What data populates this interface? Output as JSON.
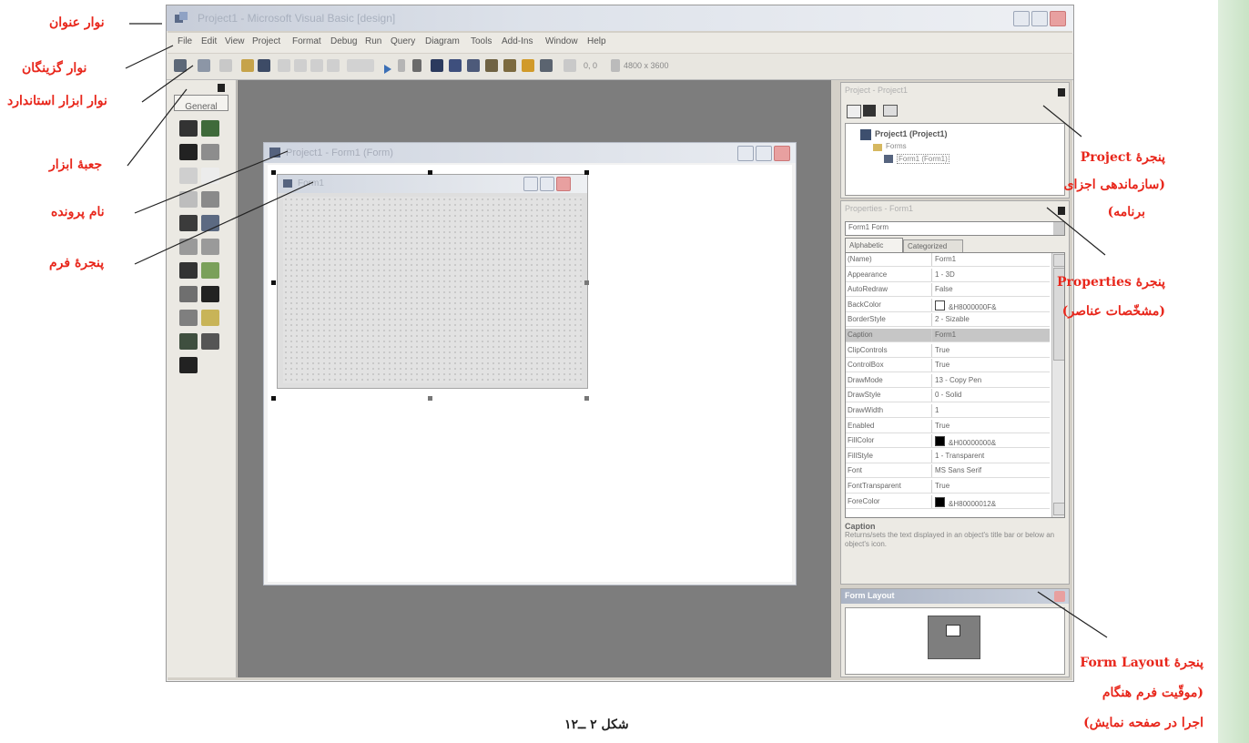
{
  "window": {
    "title": "Project1 - Microsoft Visual Basic [design]"
  },
  "menubar": [
    "File",
    "Edit",
    "View",
    "Project",
    "Format",
    "Debug",
    "Run",
    "Query",
    "Diagram",
    "Tools",
    "Add-Ins",
    "Window",
    "Help"
  ],
  "toolbar": {
    "position_readout": "0, 0",
    "size_readout": "4800 x 3600"
  },
  "toolbox": {
    "tab_label": "General",
    "tools": [
      "pointer",
      "picturebox",
      "label",
      "textbox",
      "frame",
      "commandbutton",
      "checkbox",
      "optionbutton",
      "combobox",
      "listbox",
      "hscrollbar",
      "vscrollbar",
      "timer",
      "drivelistbox",
      "dirlistbox",
      "filelistbox",
      "shape",
      "line",
      "image",
      "data",
      "ole"
    ]
  },
  "project_form_window": {
    "title": "Project1 - Form1 (Form)"
  },
  "form1": {
    "title": "Form1"
  },
  "project_explorer": {
    "title": "Project - Project1",
    "root": "Project1 (Project1)",
    "folder": "Forms",
    "item": "Form1 (Form1)"
  },
  "properties_window": {
    "title": "Properties - Form1",
    "object_selector": "Form1 Form",
    "tabs": [
      "Alphabetic",
      "Categorized"
    ],
    "rows": [
      {
        "name": "(Name)",
        "value": "Form1"
      },
      {
        "name": "Appearance",
        "value": "1 - 3D"
      },
      {
        "name": "AutoRedraw",
        "value": "False"
      },
      {
        "name": "BackColor",
        "value": "&H8000000F&",
        "swatch": "#ffffff"
      },
      {
        "name": "BorderStyle",
        "value": "2 - Sizable"
      },
      {
        "name": "Caption",
        "value": "Form1"
      },
      {
        "name": "ClipControls",
        "value": "True"
      },
      {
        "name": "ControlBox",
        "value": "True"
      },
      {
        "name": "DrawMode",
        "value": "13 - Copy Pen"
      },
      {
        "name": "DrawStyle",
        "value": "0 - Solid"
      },
      {
        "name": "DrawWidth",
        "value": "1"
      },
      {
        "name": "Enabled",
        "value": "True"
      },
      {
        "name": "FillColor",
        "value": "&H00000000&",
        "swatch": "#000000"
      },
      {
        "name": "FillStyle",
        "value": "1 - Transparent"
      },
      {
        "name": "Font",
        "value": "MS Sans Serif"
      },
      {
        "name": "FontTransparent",
        "value": "True"
      },
      {
        "name": "ForeColor",
        "value": "&H80000012&",
        "swatch": "#000000"
      }
    ],
    "selected_row": 5,
    "description_title": "Caption",
    "description_text": "Returns/sets the text displayed in an object's title bar or below an object's icon."
  },
  "form_layout_window": {
    "title": "Form Layout"
  },
  "annotations": {
    "title_bar": "نوار عنوان",
    "menu_bar": "نوار گزینگان",
    "standard_toolbar": "نوار ابزار استاندارد",
    "toolbox": "جعبهٔ ابزار",
    "file_name": "نام پرونده",
    "form_window": "پنجرهٔ فرم",
    "project_window_line1": "پنجرهٔ Project",
    "project_window_line2": "(سازماندهی اجزای",
    "project_window_line3": "برنامه)",
    "properties_window_line1": "پنجرهٔ Properties",
    "properties_window_line2": "(مشخّصات عناصر)",
    "form_layout_line1": "پنجرهٔ Form Layout",
    "form_layout_line2": "(موقّیت فرم هنگام",
    "form_layout_line3": "اجرا در صفحه نمایش)"
  },
  "caption": "شکل ۲ ــ۱۲",
  "colors": {
    "annotation_red": "#e8261b",
    "mdi_background": "#7d7d7d",
    "side_band_green": "#c9e3c5"
  }
}
